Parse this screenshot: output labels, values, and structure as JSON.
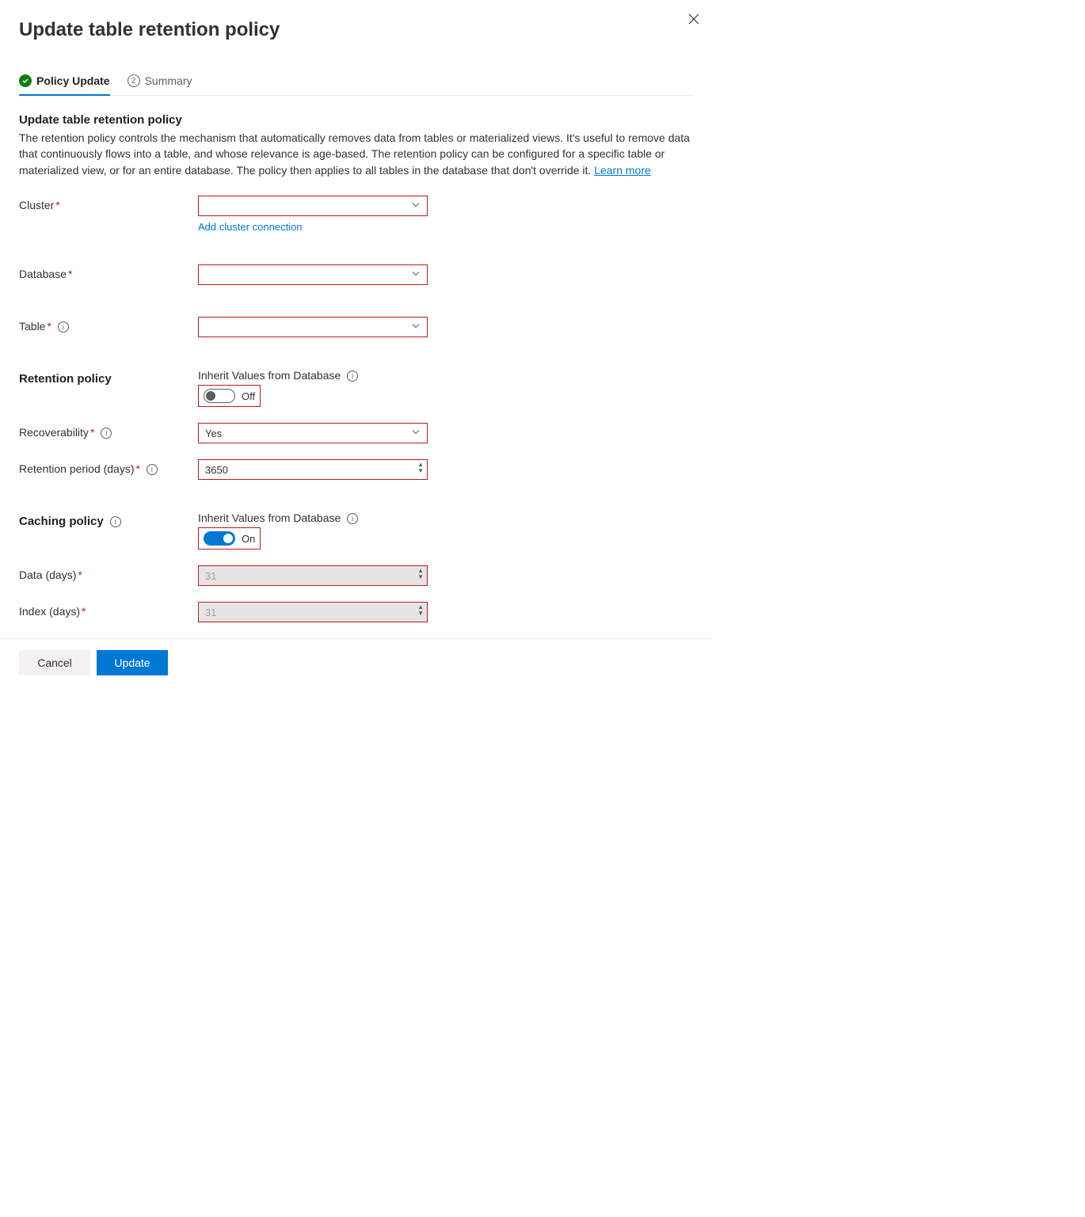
{
  "header": {
    "title": "Update table retention policy"
  },
  "tabs": {
    "policy_update": "Policy Update",
    "summary_num": "2",
    "summary": "Summary"
  },
  "intro": {
    "title": "Update table retention policy",
    "desc": "The retention policy controls the mechanism that automatically removes data from tables or materialized views. It's useful to remove data that continuously flows into a table, and whose relevance is age-based. The retention policy can be configured for a specific table or materialized view, or for an entire database. The policy then applies to all tables in the database that don't override it. ",
    "learn_more": "Learn more"
  },
  "labels": {
    "cluster": "Cluster",
    "database": "Database",
    "table": "Table",
    "retention_policy": "Retention policy",
    "inherit": "Inherit Values from Database",
    "recoverability": "Recoverability",
    "retention_period": "Retention period (days)",
    "caching_policy": "Caching policy",
    "data_days": "Data (days)",
    "index_days": "Index (days)"
  },
  "values": {
    "cluster": "",
    "add_cluster_link": "Add cluster connection",
    "database": "",
    "table": "",
    "inherit_retention_state": "Off",
    "recoverability": "Yes",
    "retention_period": "3650",
    "inherit_caching_state": "On",
    "data_days": "31",
    "index_days": "31"
  },
  "footer": {
    "cancel": "Cancel",
    "update": "Update"
  }
}
